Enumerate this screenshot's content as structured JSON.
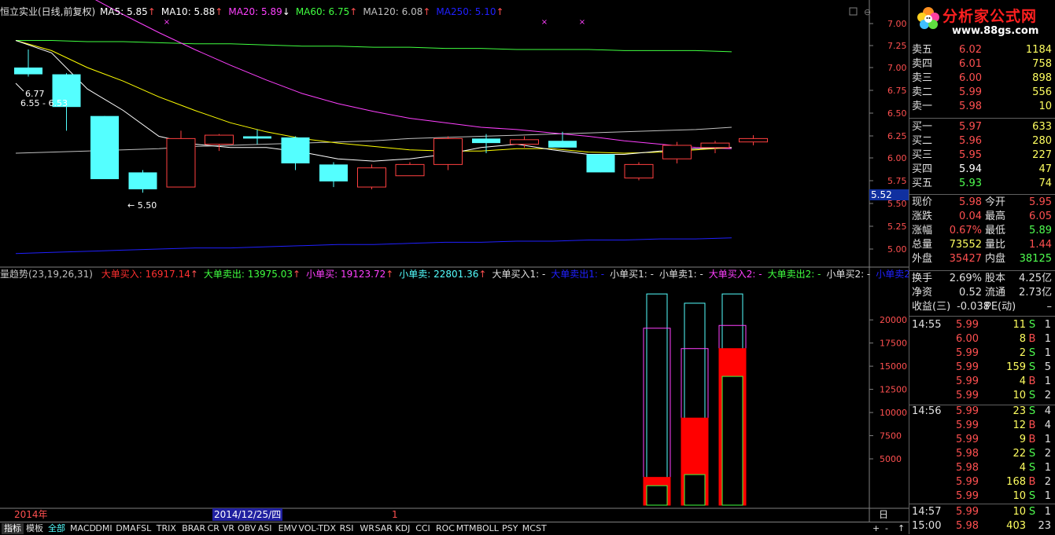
{
  "colors": {
    "up": "#ff4040",
    "down": "#54ffff",
    "ma5": "#ffffff",
    "ma10": "#ffff00",
    "ma20": "#ff40ff",
    "ma60": "#40ff40",
    "ma120": "#c0c0c0",
    "ma250": "#2020ff"
  },
  "main": {
    "title": "恒立实业(日线,前复权)",
    "ma_items": [
      {
        "label": "MA5: 5.85",
        "arrow": "↑",
        "color": "#ffffff"
      },
      {
        "label": "MA10: 5.88",
        "arrow": "↑",
        "color": "#ffffff"
      },
      {
        "label": "MA20: 5.89",
        "arrow": "↓",
        "color": "#ff40ff"
      },
      {
        "label": "MA60: 6.75",
        "arrow": "↑",
        "color": "#40ff40"
      },
      {
        "label": "MA120: 6.08",
        "arrow": "↑",
        "color": "#c0c0c0"
      },
      {
        "label": "MA250: 5.10",
        "arrow": "↑",
        "color": "#2020ff"
      }
    ],
    "price_axis": [
      "7.00",
      "7.25",
      "7.00",
      "6.75",
      "6.50",
      "6.25",
      "6.00",
      "5.75",
      "5.50",
      "5.25",
      "5.00"
    ],
    "current_price_marker": "5.52",
    "annotations": {
      "high": "6.77",
      "hl_label": "6.55 - 6.53",
      "low": "5.50"
    },
    "candles": [
      {
        "o": 6.61,
        "h": 6.77,
        "l": 6.53,
        "c": 6.55
      },
      {
        "o": 6.55,
        "h": 6.56,
        "l": 6.05,
        "c": 6.26
      },
      {
        "o": 6.18,
        "h": 6.18,
        "l": 5.62,
        "c": 5.62
      },
      {
        "o": 5.68,
        "h": 5.7,
        "l": 5.5,
        "c": 5.53
      },
      {
        "o": 5.55,
        "h": 6.05,
        "l": 5.55,
        "c": 5.98
      },
      {
        "o": 5.93,
        "h": 6.02,
        "l": 5.87,
        "c": 6.01
      },
      {
        "o": 6.0,
        "h": 6.06,
        "l": 5.93,
        "c": 5.98
      },
      {
        "o": 5.99,
        "h": 6.0,
        "l": 5.7,
        "c": 5.76
      },
      {
        "o": 5.75,
        "h": 5.77,
        "l": 5.55,
        "c": 5.6
      },
      {
        "o": 5.55,
        "h": 5.75,
        "l": 5.53,
        "c": 5.72
      },
      {
        "o": 5.65,
        "h": 5.77,
        "l": 5.65,
        "c": 5.75
      },
      {
        "o": 5.75,
        "h": 6.0,
        "l": 5.7,
        "c": 5.98
      },
      {
        "o": 5.98,
        "h": 6.02,
        "l": 5.85,
        "c": 5.94
      },
      {
        "o": 5.93,
        "h": 6.0,
        "l": 5.9,
        "c": 5.97
      },
      {
        "o": 5.96,
        "h": 6.04,
        "l": 5.9,
        "c": 5.9
      },
      {
        "o": 5.84,
        "h": 5.84,
        "l": 5.68,
        "c": 5.68
      },
      {
        "o": 5.63,
        "h": 5.77,
        "l": 5.61,
        "c": 5.75
      },
      {
        "o": 5.8,
        "h": 5.95,
        "l": 5.76,
        "c": 5.92
      },
      {
        "o": 5.9,
        "h": 5.96,
        "l": 5.85,
        "c": 5.94
      },
      {
        "o": 5.95,
        "h": 6.01,
        "l": 5.92,
        "c": 5.98
      }
    ],
    "ma_lines": {
      "ma5": [
        6.85,
        6.74,
        6.42,
        6.23,
        6.0,
        5.93,
        5.9,
        5.9,
        5.86,
        5.8,
        5.78,
        5.8,
        5.84,
        5.9,
        5.93,
        5.88,
        5.84,
        5.84,
        5.87,
        5.89,
        5.9
      ],
      "ma10": [
        6.85,
        6.76,
        6.61,
        6.49,
        6.35,
        6.23,
        6.12,
        6.04,
        5.98,
        5.94,
        5.91,
        5.88,
        5.87,
        5.87,
        5.89,
        5.89,
        5.86,
        5.85,
        5.86,
        5.88,
        5.9
      ],
      "ma20": [
        7.52,
        7.4,
        7.25,
        7.08,
        6.92,
        6.77,
        6.63,
        6.5,
        6.38,
        6.29,
        6.22,
        6.16,
        6.12,
        6.08,
        6.06,
        6.03,
        6.0,
        5.96,
        5.93,
        5.9,
        5.89
      ],
      "ma60": [
        6.85,
        6.85,
        6.84,
        6.84,
        6.83,
        6.82,
        6.82,
        6.81,
        6.8,
        6.8,
        6.79,
        6.79,
        6.78,
        6.78,
        6.77,
        6.77,
        6.77,
        6.76,
        6.76,
        6.76,
        6.75
      ],
      "ma120": [
        5.85,
        5.86,
        5.87,
        5.88,
        5.89,
        5.91,
        5.92,
        5.93,
        5.94,
        5.95,
        5.96,
        5.98,
        5.99,
        6.0,
        6.01,
        6.02,
        6.03,
        6.04,
        6.05,
        6.06,
        6.08
      ],
      "ma250": [
        4.96,
        4.97,
        4.98,
        4.99,
        5.0,
        5.01,
        5.01,
        5.02,
        5.03,
        5.04,
        5.04,
        5.05,
        5.06,
        5.06,
        5.07,
        5.07,
        5.08,
        5.08,
        5.09,
        5.09,
        5.1
      ]
    }
  },
  "indicator": {
    "title": "量趋势(23,19,26,31)",
    "items": [
      {
        "label": "大单买入: 16917.14",
        "arrow": "↑",
        "color": "#ff3030"
      },
      {
        "label": "大单卖出: 13975.03",
        "arrow": "↑",
        "color": "#40ff40"
      },
      {
        "label": "小单买: 19123.72",
        "arrow": "↑",
        "color": "#ff40ff"
      },
      {
        "label": "小单卖: 22801.36",
        "arrow": "↑",
        "color": "#54ffff"
      },
      {
        "label": "大单买入1: -",
        "arrow": "",
        "color": "#e0e0e0"
      },
      {
        "label": "大单卖出1: -",
        "arrow": "",
        "color": "#2020ff"
      },
      {
        "label": "小单买1: -",
        "arrow": "",
        "color": "#e0e0e0"
      },
      {
        "label": "小单卖1: -",
        "arrow": "",
        "color": "#e0e0e0"
      },
      {
        "label": "大单买入2: -",
        "arrow": "",
        "color": "#ff40ff"
      },
      {
        "label": "大单卖出2: -",
        "arrow": "",
        "color": "#40ff40"
      },
      {
        "label": "小单买2: -",
        "arrow": "",
        "color": "#e0e0e0"
      },
      {
        "label": "小单卖2: -",
        "arrow": "",
        "color": "#2020ff"
      }
    ],
    "axis": [
      "20000",
      "17500",
      "15000",
      "12500",
      "10000",
      "7500",
      "5000"
    ],
    "bars": [
      {
        "small_sell": 22800,
        "small_buy": 19100,
        "big_buy": 3000,
        "big_sell": 2100
      },
      {
        "small_sell": 21800,
        "small_buy": 16900,
        "big_buy": 9400,
        "big_sell": 3300
      },
      {
        "small_sell": 22800,
        "small_buy": 19400,
        "big_buy": 16900,
        "big_sell": 13900
      }
    ]
  },
  "date_bar": {
    "year": "2014年",
    "date": "2014/12/25/四",
    "mark": "1",
    "period": "日线"
  },
  "tabs": [
    "指标",
    "模板",
    "全部",
    "MACD",
    "DMI",
    "DMA",
    "FSL",
    "TRIX",
    "BRAR",
    "CR",
    "VR",
    "OBV",
    "ASI",
    "EMV",
    "VOL-TDX",
    "RSI",
    "WR",
    "SAR",
    "KDJ",
    "CCI",
    "ROC",
    "MTM",
    "BOLL",
    "PSY",
    "MCST"
  ],
  "tab_extra": [
    "+",
    "-",
    "↑"
  ],
  "logo": {
    "text": "分析家公式网",
    "url": "www.88gs.com"
  },
  "orderbook": {
    "sell": [
      {
        "label": "卖五",
        "price": "6.02",
        "vol": "1184"
      },
      {
        "label": "卖四",
        "price": "6.01",
        "vol": "758"
      },
      {
        "label": "卖三",
        "price": "6.00",
        "vol": "898"
      },
      {
        "label": "卖二",
        "price": "5.99",
        "vol": "556"
      },
      {
        "label": "卖一",
        "price": "5.98",
        "vol": "10"
      }
    ],
    "buy": [
      {
        "label": "买一",
        "price": "5.97",
        "vol": "633",
        "color": "#ff5050"
      },
      {
        "label": "买二",
        "price": "5.96",
        "vol": "280",
        "color": "#ff5050"
      },
      {
        "label": "买三",
        "price": "5.95",
        "vol": "227",
        "color": "#ff5050"
      },
      {
        "label": "买四",
        "price": "5.94",
        "vol": "47",
        "color": "#ffffff"
      },
      {
        "label": "买五",
        "price": "5.93",
        "vol": "74",
        "color": "#50ff50"
      }
    ]
  },
  "stats": [
    {
      "l1": "现价",
      "v1": "5.98",
      "c1": "#ff5050",
      "l2": "今开",
      "v2": "5.95",
      "c2": "#ff5050"
    },
    {
      "l1": "涨跌",
      "v1": "0.04",
      "c1": "#ff5050",
      "l2": "最高",
      "v2": "6.05",
      "c2": "#ff5050"
    },
    {
      "l1": "涨幅",
      "v1": "0.67%",
      "c1": "#ff5050",
      "l2": "最低",
      "v2": "5.89",
      "c2": "#50ff50"
    },
    {
      "l1": "总量",
      "v1": "73552",
      "c1": "#ffff60",
      "l2": "量比",
      "v2": "1.44",
      "c2": "#ff5050"
    },
    {
      "l1": "外盘",
      "v1": "35427",
      "c1": "#ff5050",
      "l2": "内盘",
      "v2": "38125",
      "c2": "#50ff50"
    }
  ],
  "stats2": [
    {
      "l1": "换手",
      "v1": "2.69%",
      "c1": "#e0e0e0",
      "l2": "股本",
      "v2": "4.25亿",
      "c2": "#e0e0e0"
    },
    {
      "l1": "净资",
      "v1": "0.52",
      "c1": "#e0e0e0",
      "l2": "流通",
      "v2": "2.73亿",
      "c2": "#e0e0e0"
    },
    {
      "l1": "收益(三)",
      "v1": "-0.038",
      "c1": "#e0e0e0",
      "l2": "PE(动)",
      "v2": "–",
      "c2": "#e0e0e0"
    }
  ],
  "ticks": [
    {
      "t": "14:55",
      "p": "5.99",
      "v": "11",
      "d": "S",
      "n": "1"
    },
    {
      "t": "",
      "p": "6.00",
      "v": "8",
      "d": "B",
      "n": "1"
    },
    {
      "t": "",
      "p": "5.99",
      "v": "2",
      "d": "S",
      "n": "1"
    },
    {
      "t": "",
      "p": "5.99",
      "v": "159",
      "d": "S",
      "n": "5"
    },
    {
      "t": "",
      "p": "5.99",
      "v": "4",
      "d": "B",
      "n": "1"
    },
    {
      "t": "",
      "p": "5.99",
      "v": "10",
      "d": "S",
      "n": "2"
    },
    {
      "t": "14:56",
      "p": "5.99",
      "v": "23",
      "d": "S",
      "n": "4"
    },
    {
      "t": "",
      "p": "5.99",
      "v": "12",
      "d": "B",
      "n": "4"
    },
    {
      "t": "",
      "p": "5.99",
      "v": "9",
      "d": "B",
      "n": "1"
    },
    {
      "t": "",
      "p": "5.98",
      "v": "22",
      "d": "S",
      "n": "2"
    },
    {
      "t": "",
      "p": "5.98",
      "v": "4",
      "d": "S",
      "n": "1"
    },
    {
      "t": "",
      "p": "5.99",
      "v": "168",
      "d": "B",
      "n": "2"
    },
    {
      "t": "",
      "p": "5.99",
      "v": "10",
      "d": "S",
      "n": "1"
    },
    {
      "t": "14:57",
      "p": "5.99",
      "v": "10",
      "d": "S",
      "n": "1"
    },
    {
      "t": "15:00",
      "p": "5.98",
      "v": "403",
      "d": "",
      "n": "23"
    }
  ]
}
